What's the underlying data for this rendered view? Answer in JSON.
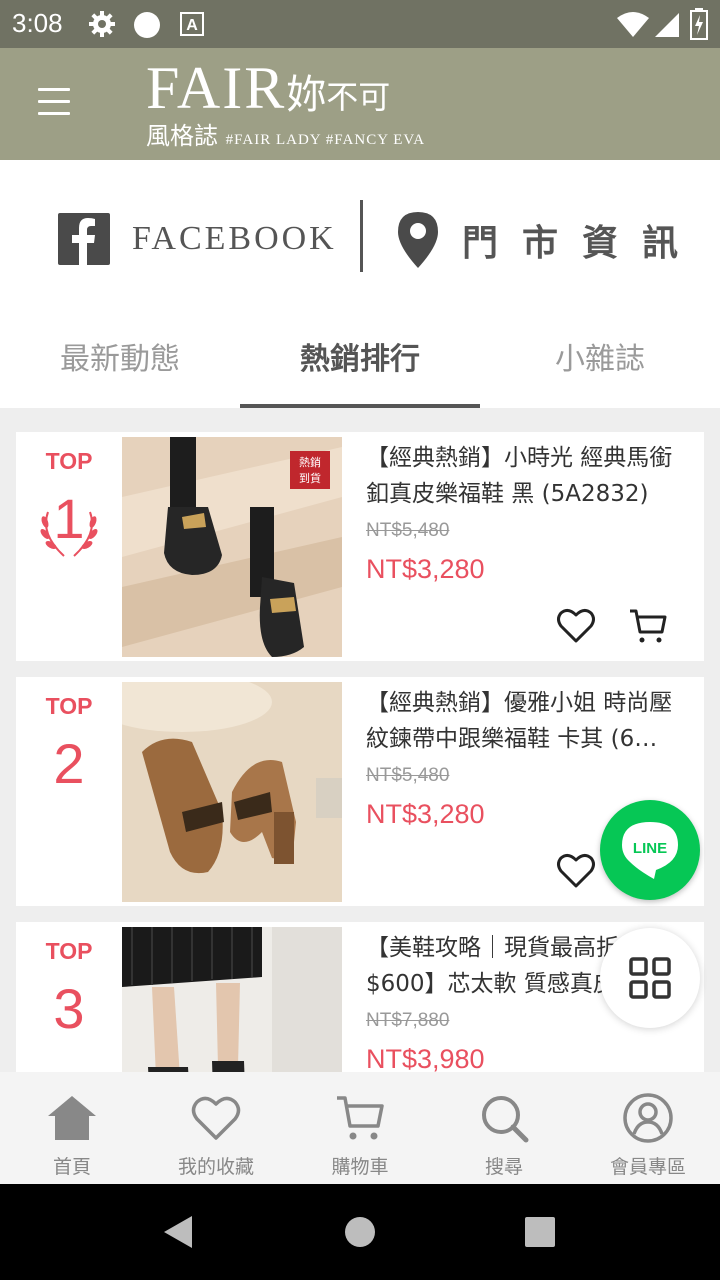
{
  "status_bar": {
    "time": "3:08",
    "icons": [
      "gear-icon",
      "circle-icon",
      "a11y-icon",
      "wifi-icon",
      "signal-icon",
      "battery-icon"
    ]
  },
  "app_bar": {
    "brand_latin": "FAIR",
    "brand_cn_big": "妳",
    "brand_cn_small": "不可",
    "subtitle": "風格誌",
    "tags": "#FAIR LADY #FANCY EVA",
    "background": "#9d9f86"
  },
  "links": {
    "facebook_label": "FACEBOOK",
    "store_label": "門市資訊"
  },
  "tabs": [
    {
      "label": "最新動態",
      "active": false
    },
    {
      "label": "熱銷排行",
      "active": true
    },
    {
      "label": "小雜誌",
      "active": false
    }
  ],
  "ranking": {
    "top_label": "TOP",
    "items": [
      {
        "rank": "1",
        "title": "【經典熱銷】小時光 經典馬銜釦真皮樂福鞋 黑 (5A2832)",
        "original_price": "NT$5,480",
        "price": "NT$3,280",
        "badge": "熱銷到貨"
      },
      {
        "rank": "2",
        "title": "【經典熱銷】優雅小姐 時尚壓紋鍊帶中跟樂福鞋 卡其 (6…",
        "original_price": "NT$5,480",
        "price": "NT$3,280"
      },
      {
        "rank": "3",
        "title": "【美鞋攻略｜現貨最高折$600】芯太軟 質感真皮",
        "original_price": "NT$7,880",
        "price": "NT$3,980"
      }
    ]
  },
  "floating": {
    "line_label": "LINE"
  },
  "bottom_nav": [
    {
      "label": "首頁",
      "icon": "home-icon"
    },
    {
      "label": "我的收藏",
      "icon": "heart-icon"
    },
    {
      "label": "購物車",
      "icon": "cart-icon"
    },
    {
      "label": "搜尋",
      "icon": "search-icon"
    },
    {
      "label": "會員專區",
      "icon": "user-icon"
    }
  ],
  "colors": {
    "accent": "#e9505f",
    "header": "#9d9f86",
    "status_bar": "#707263",
    "line_green": "#06c755"
  }
}
